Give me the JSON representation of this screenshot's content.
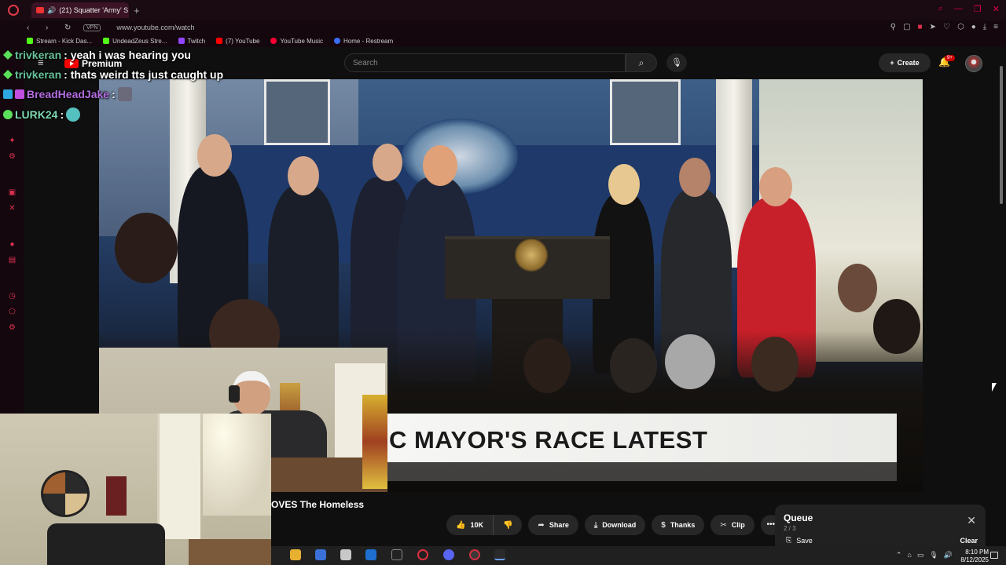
{
  "browser": {
    "tab_title": "(21) Squatter 'Army' S",
    "vpn_label": "VPN",
    "url": "www.youtube.com/watch",
    "bookmarks": [
      {
        "label": "Stream - Kick Das...",
        "color": "#53fc18"
      },
      {
        "label": "UndeadZeus Stre...",
        "color": "#53fc18"
      },
      {
        "label": "Twitch",
        "color": "#9146ff"
      },
      {
        "label": "(7) YouTube",
        "color": "#ff0000"
      },
      {
        "label": "YouTube Music",
        "color": "#ff0033"
      },
      {
        "label": "Home - Restream",
        "color": "#3b6cf6"
      }
    ]
  },
  "youtube": {
    "logo_text": "Premium",
    "search_placeholder": "Search",
    "create_label": "Create",
    "notification_count": "9+"
  },
  "chat": {
    "messages": [
      {
        "user": "trivkeran",
        "text": ": yeah i was hearing you",
        "color": "#67c29b"
      },
      {
        "user": "trivkeran",
        "text": ": thats weird tts just caught up",
        "color": "#67c29b"
      },
      {
        "user": "BreadHeadJake",
        "text": ":",
        "color": "#b36de0"
      },
      {
        "user": "LURK24",
        "text": ":",
        "color": "#7dd8b0"
      }
    ]
  },
  "video": {
    "lower_third": "C MAYOR'S RACE LATEST",
    "title": "OVES The Homeless"
  },
  "actions": {
    "like_count": "10K",
    "share": "Share",
    "download": "Download",
    "thanks": "Thanks",
    "clip": "Clip"
  },
  "queue": {
    "title": "Queue",
    "count": "2 / 3",
    "save": "Save",
    "clear": "Clear"
  },
  "taskbar": {
    "time": "8:10 PM",
    "date": "8/12/2025"
  }
}
